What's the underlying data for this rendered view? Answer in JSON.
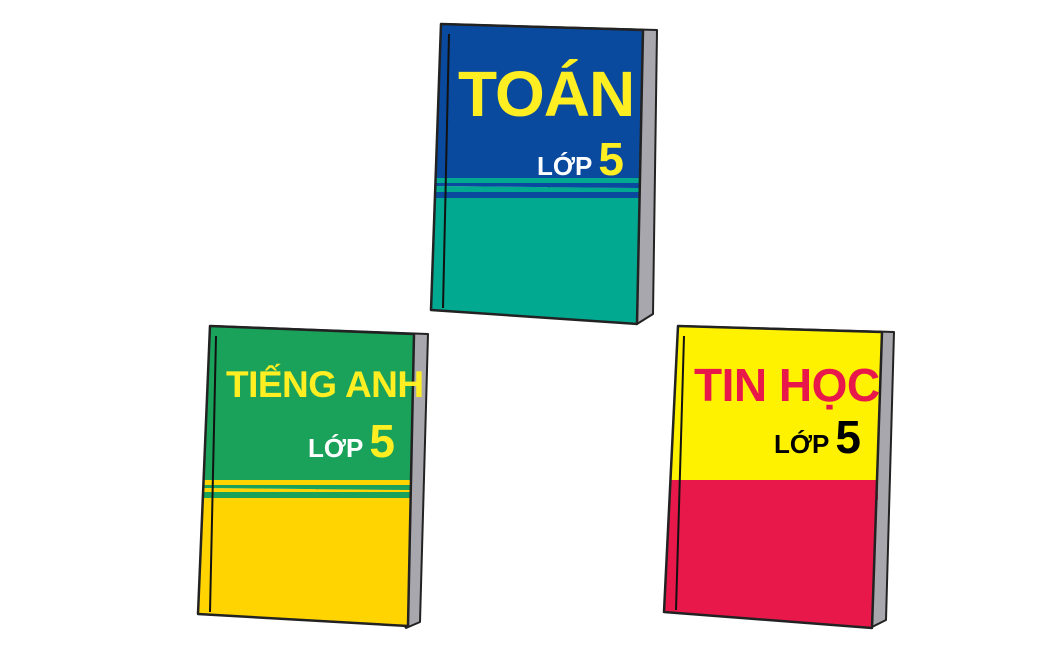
{
  "books": [
    {
      "id": "toan",
      "title": "TOÁN",
      "grade_label": "LỚP",
      "grade_number": "5",
      "colors": {
        "top": "#0a4a9e",
        "bottom": "#00a98f",
        "stripe": "#0a4a9e",
        "title": "#ffee22",
        "grade_label": "#ffffff",
        "grade_number": "#ffee22"
      }
    },
    {
      "id": "tieng-anh",
      "title": "TIẾNG ANH",
      "grade_label": "LỚP",
      "grade_number": "5",
      "colors": {
        "top": "#1aa25b",
        "bottom": "#ffd400",
        "stripe": "#1aa25b",
        "title": "#ffee22",
        "grade_label": "#ffffff",
        "grade_number": "#ffee22"
      }
    },
    {
      "id": "tin-hoc",
      "title": "TIN HỌC",
      "grade_label": "LỚP",
      "grade_number": "5",
      "colors": {
        "top": "#fff200",
        "bottom": "#e8194a",
        "stripe": "#e8194a",
        "title": "#e8194a",
        "grade_label": "#000000",
        "grade_number": "#000000"
      }
    }
  ]
}
